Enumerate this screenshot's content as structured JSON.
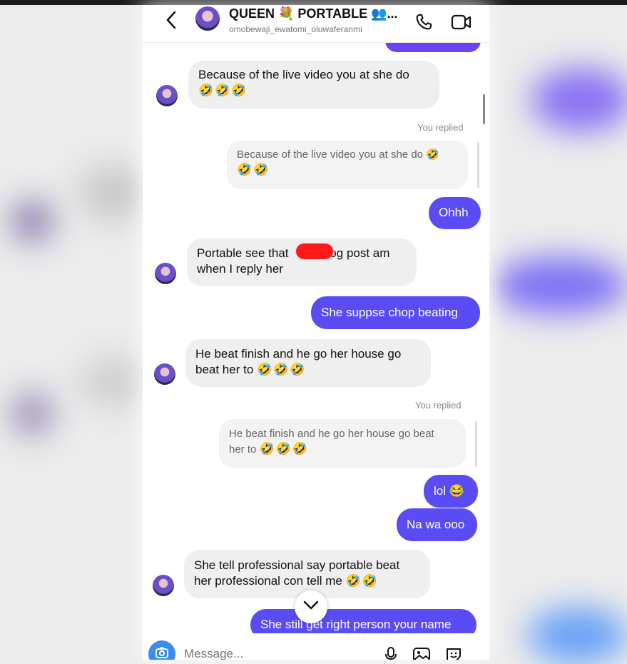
{
  "header": {
    "title": "QUEEN 💐 PORTABLE 👥...",
    "username": "omobewaji_ewatomi_oluwaferanmi"
  },
  "messages": {
    "m1_text": "Because of the live video you at she do",
    "m1_emoji": "🤣🤣🤣",
    "you_replied_1": "You replied",
    "r1_text": "Because of the live video you at she do 🤣",
    "r1_emoji": "🤣🤣",
    "o1": "Ohhh",
    "m2_line1_a": "Portable see that",
    "m2_line1_b": "log post am",
    "m2_line2": "when I reply her",
    "o2": "She suppse chop beating",
    "m3_line1": "He beat finish and he go her house go",
    "m3_line2": "beat her to",
    "m3_emoji": "🤣🤣🤣",
    "you_replied_2": "You replied",
    "r2_line1": "He beat finish and he go her house go beat",
    "r2_line2": "her to",
    "r2_emoji": "🤣🤣🤣",
    "o3": "lol 😂",
    "o4": "Na wa ooo",
    "m4_line1": "She tell professional say portable beat",
    "m4_line2": "her professional con tell me",
    "m4_emoji": "🤣🤣",
    "o5": "She still get right person your name"
  },
  "composer": {
    "placeholder": "Message..."
  },
  "colors": {
    "outgoing": "#5a4cf5",
    "incoming": "#efefef",
    "camera": "#3b8cf0"
  },
  "icons": [
    "chevron-left-icon",
    "phone-icon",
    "video-icon",
    "chevron-down-icon",
    "camera-icon",
    "microphone-icon",
    "gallery-icon",
    "sticker-icon"
  ]
}
